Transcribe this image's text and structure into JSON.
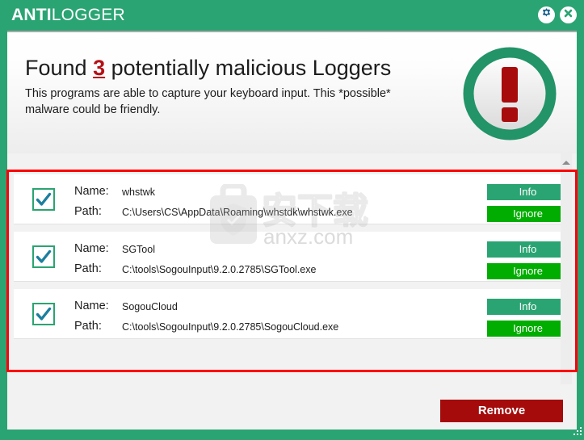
{
  "window": {
    "brand_strong": "ANTI",
    "brand_light": "LOGGER",
    "accent_green": "#2aa472",
    "bright_green": "#00ad00",
    "alert_red": "#a50b0b",
    "annotation_red": "#fc0008"
  },
  "titlebar": {
    "settings_icon": "gear-icon",
    "close_icon": "close-icon"
  },
  "banner": {
    "heading_prefix": "Found ",
    "count": "3",
    "heading_suffix": " potentially malicious Loggers",
    "subtext": "This programs are able to capture your keyboard input. This *possible* malware could be friendly.",
    "alert_icon": "exclamation-circle-icon"
  },
  "list": {
    "name_label": "Name:",
    "path_label": "Path:",
    "info_label": "Info",
    "ignore_label": "Ignore",
    "rows": [
      {
        "checked": true,
        "name": "whstwk",
        "path": "C:\\Users\\CS\\AppData\\Roaming\\whstdk\\whstwk.exe"
      },
      {
        "checked": true,
        "name": "SGTool",
        "path": "C:\\tools\\SogouInput\\9.2.0.2785\\SGTool.exe"
      },
      {
        "checked": true,
        "name": "SogouCloud",
        "path": "C:\\tools\\SogouInput\\9.2.0.2785\\SogouCloud.exe"
      }
    ]
  },
  "footer": {
    "remove_label": "Remove"
  },
  "watermark": {
    "cjk_text": "安下载",
    "site_text": "anxz.com"
  }
}
